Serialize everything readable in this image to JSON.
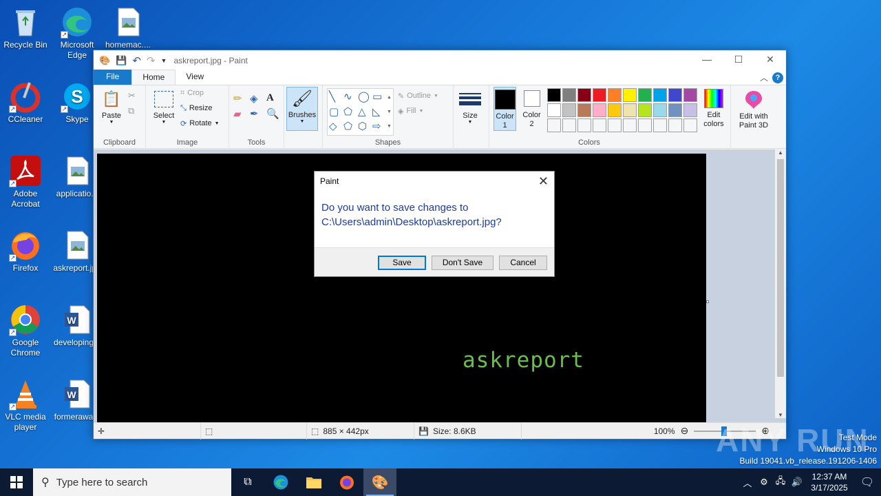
{
  "desktop": {
    "icons": [
      {
        "label": "Recycle Bin"
      },
      {
        "label": "Microsoft Edge"
      },
      {
        "label": "homemac...."
      },
      {
        "label": "CCleaner"
      },
      {
        "label": "Skype"
      },
      {
        "label": "Adobe Acrobat"
      },
      {
        "label": "applicatio..."
      },
      {
        "label": "Firefox"
      },
      {
        "label": "askreport.jpg"
      },
      {
        "label": "Google Chrome"
      },
      {
        "label": "developing..."
      },
      {
        "label": "VLC media player"
      },
      {
        "label": "formerawa..."
      }
    ],
    "watermark_brand": "ANY RUN",
    "system_info": [
      "Test Mode",
      "Windows 10 Pro",
      "Build 19041.vb_release.191206-1406"
    ]
  },
  "paint": {
    "title": "askreport.jpg - Paint",
    "menu": {
      "file": "File",
      "home": "Home",
      "view": "View",
      "help": "?"
    },
    "ribbon": {
      "clipboard": {
        "label": "Clipboard",
        "paste": "Paste"
      },
      "image": {
        "label": "Image",
        "select": "Select",
        "crop": "Crop",
        "resize": "Resize",
        "rotate": "Rotate"
      },
      "tools": {
        "label": "Tools"
      },
      "brushes": "Brushes",
      "shapes": {
        "label": "Shapes",
        "outline": "Outline",
        "fill": "Fill"
      },
      "size": "Size",
      "color1": "Color 1",
      "color2": "Color 2",
      "colors_label": "Colors",
      "edit_colors": "Edit colors",
      "edit_3d": "Edit with Paint 3D",
      "palette_row1": [
        "#000000",
        "#7f7f7f",
        "#880015",
        "#ed1c24",
        "#ff7f27",
        "#fff200",
        "#22b14c",
        "#00a2e8",
        "#3f48cc",
        "#a349a4"
      ],
      "palette_row2": [
        "#ffffff",
        "#c3c3c3",
        "#b97a57",
        "#ffaec9",
        "#ffc90e",
        "#efe4b0",
        "#b5e61d",
        "#99d9ea",
        "#7092be",
        "#c8bfe7"
      ],
      "color1_value": "#000000",
      "color2_value": "#ffffff"
    },
    "canvas_text": "askreport",
    "status": {
      "dimensions": "885 × 442px",
      "size": "Size: 8.6KB",
      "zoom": "100%"
    }
  },
  "dialog": {
    "title": "Paint",
    "message_line1": "Do you want to save changes to",
    "message_line2": "C:\\Users\\admin\\Desktop\\askreport.jpg?",
    "save": "Save",
    "dont_save": "Don't Save",
    "cancel": "Cancel"
  },
  "taskbar": {
    "search_placeholder": "Type here to search",
    "time": "12:37 AM",
    "date": "3/17/2025"
  }
}
